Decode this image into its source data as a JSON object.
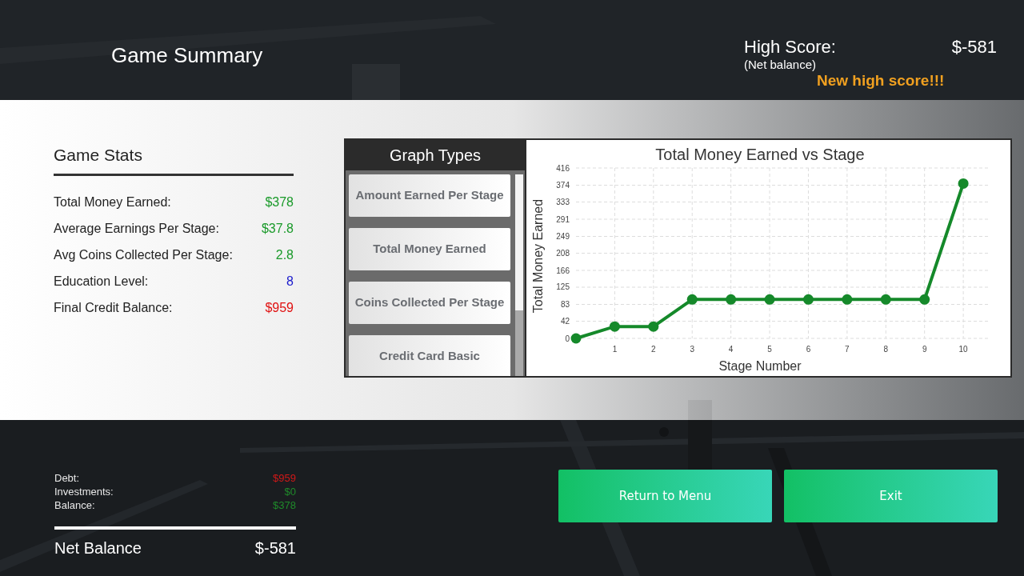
{
  "title": "Game Summary",
  "high_score": {
    "label": "High Score:",
    "note": "(Net balance)",
    "value": "$-581",
    "new_record": true,
    "new_record_text": "New high score!!!"
  },
  "game_stats": {
    "heading": "Game Stats",
    "rows": [
      {
        "label": "Total Money Earned:",
        "value": "$378",
        "color": "#1a9a2a"
      },
      {
        "label": "Average Earnings Per Stage:",
        "value": "$37.8",
        "color": "#1a9a2a"
      },
      {
        "label": "Avg Coins Collected Per Stage:",
        "value": "2.8",
        "color": "#1a9a2a"
      },
      {
        "label": "Education Level:",
        "value": "8",
        "color": "#1a1acc"
      },
      {
        "label": "Final Credit Balance:",
        "value": "$959",
        "color": "#e01010"
      }
    ]
  },
  "graph_types": {
    "heading": "Graph Types",
    "items": [
      {
        "label": "Amount Earned Per Stage"
      },
      {
        "label": "Total Money Earned"
      },
      {
        "label": "Coins Collected Per Stage"
      },
      {
        "label": "Credit Card Basic"
      }
    ]
  },
  "chart_data": {
    "type": "line",
    "title": "Total Money Earned vs Stage",
    "xlabel": "Stage Number",
    "ylabel": "Total Money Earned",
    "x": [
      0,
      1,
      2,
      3,
      4,
      5,
      6,
      7,
      8,
      9,
      10
    ],
    "grid": true,
    "series": [
      {
        "color": "#15892a",
        "marker": "circle",
        "values": [
          0,
          29,
          29,
          95,
          95,
          95,
          95,
          95,
          95,
          95,
          378
        ]
      }
    ],
    "xlim": [
      0,
      10.7
    ],
    "ylim": [
      0,
      416
    ],
    "xticks": [
      1,
      2,
      3,
      4,
      5,
      6,
      7,
      8,
      9,
      10
    ],
    "yticks": [
      0,
      42,
      83,
      125,
      166,
      208,
      249,
      291,
      333,
      374,
      416
    ]
  },
  "ledger": {
    "rows": [
      {
        "label": "Debt:",
        "value": "$959",
        "color": "#d01818"
      },
      {
        "label": "Investments:",
        "value": "$0",
        "color": "#1f8a2a"
      },
      {
        "label": "Balance:",
        "value": "$378",
        "color": "#1f8a2a"
      }
    ],
    "total_label": "Net Balance",
    "total_value": "$-581"
  },
  "buttons": [
    {
      "label": "Return to Menu"
    },
    {
      "label": "Exit"
    }
  ]
}
